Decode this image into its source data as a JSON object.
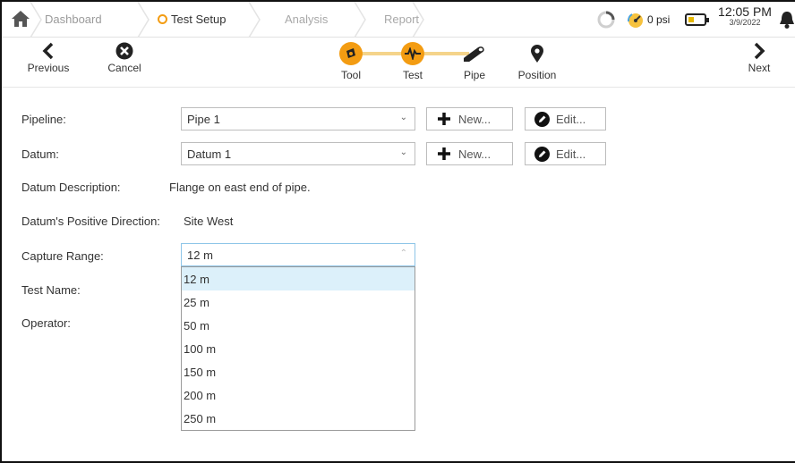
{
  "breadcrumb": {
    "items": [
      "Dashboard",
      "Test Setup",
      "Analysis",
      "Report"
    ],
    "active_index": 1
  },
  "status": {
    "pressure": "0 psi",
    "time": "12:05 PM",
    "date": "3/9/2022",
    "battery_level": 0.35
  },
  "toolbar": {
    "previous_label": "Previous",
    "cancel_label": "Cancel",
    "next_label": "Next"
  },
  "steps": [
    {
      "label": "Tool",
      "icon": "tool-icon",
      "state": "complete"
    },
    {
      "label": "Test",
      "icon": "waveform-icon",
      "state": "active"
    },
    {
      "label": "Pipe",
      "icon": "pipe-icon",
      "state": "pending"
    },
    {
      "label": "Position",
      "icon": "location-pin-icon",
      "state": "pending"
    }
  ],
  "form": {
    "pipeline_label": "Pipeline:",
    "pipeline_value": "Pipe 1",
    "datum_label": "Datum:",
    "datum_value": "Datum 1",
    "new_label": "New...",
    "edit_label": "Edit...",
    "datum_description_label": "Datum Description:",
    "datum_description_value": "Flange on east end of pipe.",
    "datum_direction_label": "Datum's Positive Direction:",
    "datum_direction_value": "Site West",
    "capture_range_label": "Capture Range:",
    "capture_range_value": "12 m",
    "test_name_label": "Test Name:",
    "operator_label": "Operator:"
  },
  "capture_range_options": [
    "12 m",
    "25 m",
    "50 m",
    "100 m",
    "150 m",
    "200 m",
    "250 m"
  ],
  "colors": {
    "accent": "#f39c12",
    "selected_option_bg": "#dcf0fa"
  }
}
